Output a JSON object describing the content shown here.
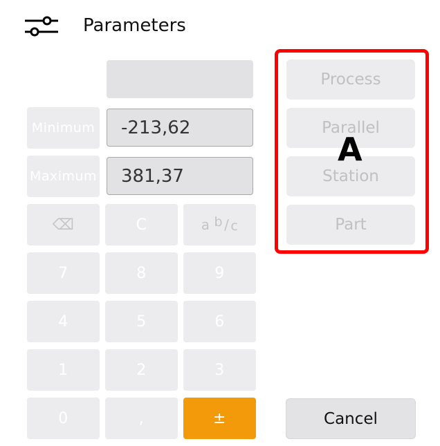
{
  "header": {
    "title": "Parameters",
    "icon": "sliders-icon"
  },
  "fields": {
    "top_value": "",
    "minimum_label": "Minimum",
    "minimum_value": "-213,62",
    "maximum_label": "Maximum",
    "maximum_value": "381,37"
  },
  "keypad": {
    "backspace": "⌫",
    "clear": "C",
    "fraction_a": "a",
    "fraction_b": "b",
    "fraction_slash": "/",
    "fraction_c": "c",
    "k7": "7",
    "k8": "8",
    "k9": "9",
    "k4": "4",
    "k5": "5",
    "k6": "6",
    "k1": "1",
    "k2": "2",
    "k3": "3",
    "k0": "0",
    "comma": ",",
    "plus_minus": "±"
  },
  "options": {
    "process": "Process",
    "parallel": "Parallel",
    "station": "Station",
    "part": "Part"
  },
  "actions": {
    "cancel": "Cancel"
  },
  "annotation": {
    "label": "A",
    "color": "#ff0000"
  },
  "colors": {
    "accent": "#f39a0a",
    "key_bg": "#ececee"
  }
}
